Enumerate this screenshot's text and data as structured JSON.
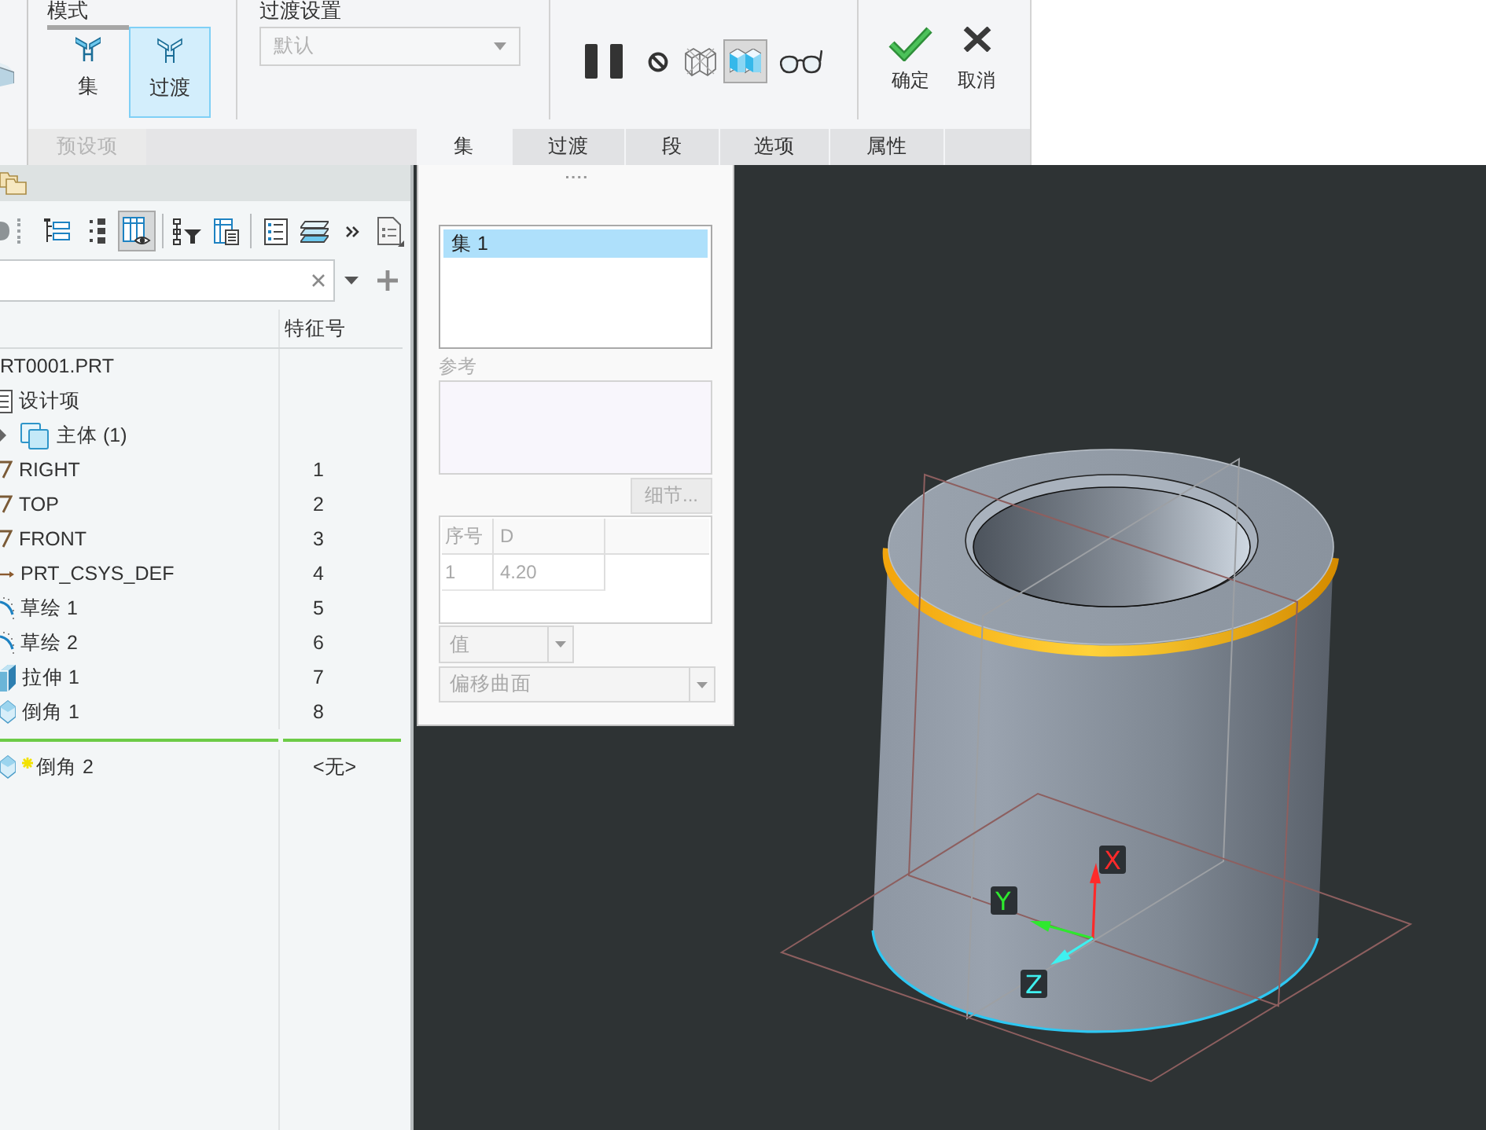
{
  "ribbon": {
    "mode_group": {
      "title": "模式",
      "buttons": [
        {
          "kind": "set",
          "label": "集",
          "selected": false
        },
        {
          "kind": "transition",
          "label": "过渡",
          "selected": true
        }
      ]
    },
    "transition_group": {
      "title": "过渡设置",
      "dropdown": {
        "value": "默认",
        "disabled": true
      }
    },
    "preview_tools": [
      {
        "kind": "pause",
        "on": false
      },
      {
        "kind": "no-preview",
        "on": false
      },
      {
        "kind": "wireframe-preview",
        "on": false
      },
      {
        "kind": "shaded-preview",
        "on": true
      },
      {
        "kind": "verify",
        "on": false
      }
    ],
    "actions": [
      {
        "kind": "ok",
        "label": "确定"
      },
      {
        "kind": "cancel",
        "label": "取消"
      }
    ],
    "presets": {
      "label": "预设项",
      "disabled": true
    },
    "tabs": [
      {
        "label": "集",
        "selected": true
      },
      {
        "label": "过渡",
        "selected": false
      },
      {
        "label": "段",
        "selected": false
      },
      {
        "label": "选项",
        "selected": false
      },
      {
        "label": "属性",
        "selected": false
      }
    ]
  },
  "model_tree": {
    "toolbar": [
      [
        {
          "kind": "cut-off",
          "on": false
        }
      ],
      [
        {
          "kind": "tree-list",
          "on": false
        },
        {
          "kind": "dotted-list",
          "on": false
        },
        {
          "kind": "columns-eye",
          "on": true
        }
      ],
      [
        {
          "kind": "tree-filter",
          "on": false
        },
        {
          "kind": "column-settings",
          "on": false
        }
      ],
      [
        {
          "kind": "list-details",
          "on": false
        },
        {
          "kind": "layers",
          "on": false
        },
        {
          "kind": "more",
          "on": false
        },
        {
          "kind": "document",
          "on": false
        }
      ]
    ],
    "column_2": "特征号",
    "root": {
      "name": "RT0001.PRT",
      "new": false,
      "children": [
        {
          "name": "设计项",
          "kind": "design-items",
          "new": false
        },
        {
          "name": "主体 (1)",
          "kind": "bodies",
          "new": false
        },
        {
          "name": "RIGHT",
          "kind": "datum-plane",
          "id": "1",
          "new": false
        },
        {
          "name": "TOP",
          "kind": "datum-plane",
          "id": "2",
          "new": false
        },
        {
          "name": "FRONT",
          "kind": "datum-plane",
          "id": "3",
          "new": false
        },
        {
          "name": "PRT_CSYS_DEF",
          "kind": "csys",
          "id": "4",
          "new": false
        },
        {
          "name": "草绘 1",
          "kind": "sketch",
          "id": "5",
          "new": false
        },
        {
          "name": "草绘 2",
          "kind": "sketch",
          "id": "6",
          "new": false
        },
        {
          "name": "拉伸 1",
          "kind": "extrude",
          "id": "7",
          "new": false
        },
        {
          "name": "倒角 1",
          "kind": "chamfer",
          "id": "8",
          "new": false
        }
      ],
      "after_insert_marker": [
        {
          "name": "倒角 2",
          "kind": "chamfer",
          "id": "<无>",
          "new": true
        }
      ]
    }
  },
  "sets_panel": {
    "sets": [
      {
        "label": "集 1",
        "selected": true
      }
    ],
    "references": {
      "label": "参考",
      "disabled": true
    },
    "details_button": {
      "label": "细节...",
      "disabled": true
    },
    "table": {
      "columns": [
        "序号",
        "D"
      ],
      "rows": [
        [
          "1",
          "4.20"
        ]
      ],
      "disabled": true
    },
    "value_dropdown": {
      "value": "值",
      "disabled": true
    },
    "offset_dropdown": {
      "value": "偏移曲面",
      "disabled": true
    }
  },
  "viewport": {
    "axes": [
      {
        "label": "X",
        "color": "#ff2a2a"
      },
      {
        "label": "Y",
        "color": "#2ee82e"
      },
      {
        "label": "Z",
        "color": "#3ff0f0"
      }
    ]
  }
}
